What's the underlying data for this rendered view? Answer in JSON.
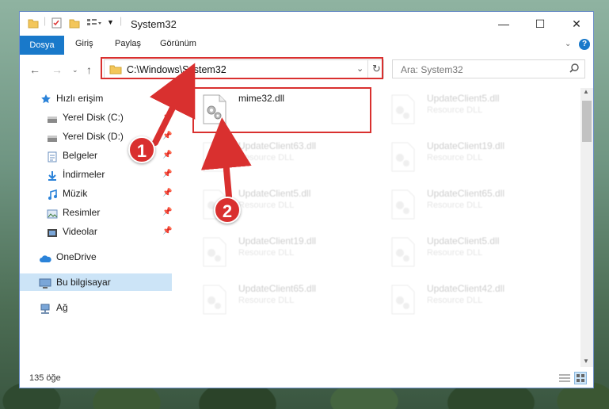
{
  "titlebar": {
    "title": "System32",
    "minimize_glyph": "—",
    "maximize_glyph": "☐",
    "close_glyph": "✕"
  },
  "ribbon": {
    "tabs": [
      "Dosya",
      "Giriş",
      "Paylaş",
      "Görünüm"
    ],
    "help_glyph": "?"
  },
  "address": {
    "path": "C:\\Windows\\System32",
    "search_placeholder": "Ara: System32"
  },
  "sidebar": {
    "items": [
      {
        "label": "Hızlı erişim",
        "icon": "star-icon",
        "pinned": false
      },
      {
        "label": "Yerel Disk (C:)",
        "icon": "drive-icon",
        "pinned": true
      },
      {
        "label": "Yerel Disk (D:)",
        "icon": "drive-icon",
        "pinned": true
      },
      {
        "label": "Belgeler",
        "icon": "documents-icon",
        "pinned": true
      },
      {
        "label": "İndirmeler",
        "icon": "downloads-icon",
        "pinned": true
      },
      {
        "label": "Müzik",
        "icon": "music-icon",
        "pinned": true
      },
      {
        "label": "Resimler",
        "icon": "pictures-icon",
        "pinned": true
      },
      {
        "label": "Videolar",
        "icon": "videos-icon",
        "pinned": true
      },
      {
        "label": "OneDrive",
        "icon": "cloud-icon",
        "pinned": false
      },
      {
        "label": "Bu bilgisayar",
        "icon": "computer-icon",
        "pinned": false,
        "selected": true
      },
      {
        "label": "Ağ",
        "icon": "network-icon",
        "pinned": false
      }
    ]
  },
  "files": [
    {
      "name": "mime32.dll",
      "type": "",
      "highlighted": true
    },
    {
      "name": "UpdateClient5.dll",
      "type": "Resource DLL"
    },
    {
      "name": "UpdateClient63.dll",
      "type": "Resource DLL"
    },
    {
      "name": "UpdateClient19.dll",
      "type": "Resource DLL"
    },
    {
      "name": "UpdateClient5.dll",
      "type": "Resource DLL"
    },
    {
      "name": "UpdateClient65.dll",
      "type": "Resource DLL"
    },
    {
      "name": "UpdateClient19.dll",
      "type": "Resource DLL"
    },
    {
      "name": "UpdateClient5.dll",
      "type": "Resource DLL"
    },
    {
      "name": "UpdateClient65.dll",
      "type": "Resource DLL"
    },
    {
      "name": "UpdateClient42.dll",
      "type": "Resource DLL"
    }
  ],
  "status": {
    "item_count": "135 öğe"
  },
  "annotations": {
    "step1": "1",
    "step2": "2"
  },
  "colors": {
    "accent": "#1979ca",
    "highlight": "#d9302f",
    "selected_bg": "#cce4f7"
  }
}
